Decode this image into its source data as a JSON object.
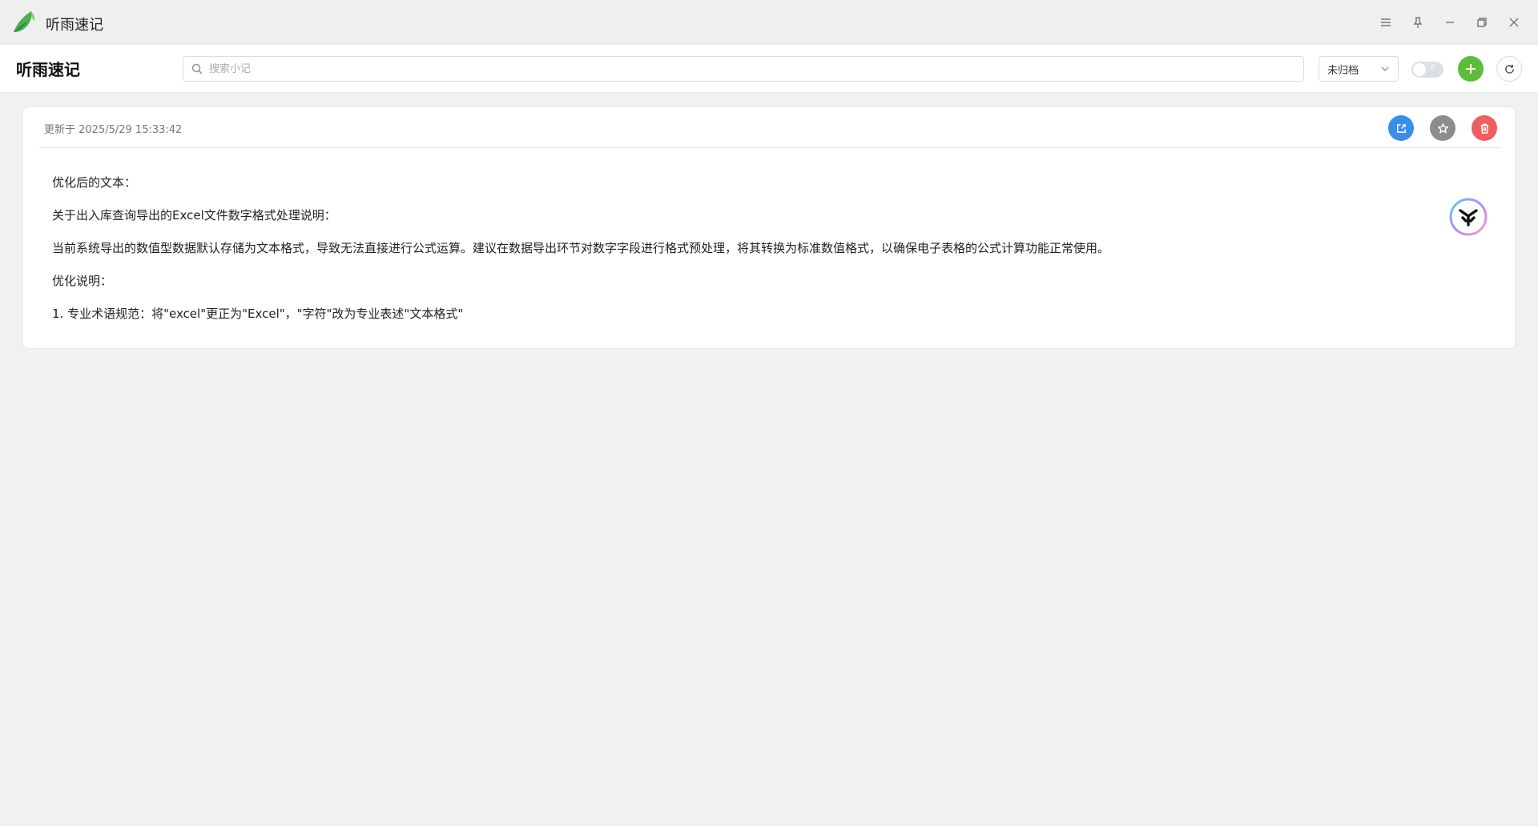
{
  "window": {
    "title": "听雨速记",
    "controls": [
      "menu-icon",
      "pin-icon",
      "minimize-icon",
      "restore-icon",
      "close-icon"
    ]
  },
  "toolbar": {
    "page_title": "听雨速记",
    "search_placeholder": "搜索小记",
    "search_value": "",
    "filter_selected": "未归档",
    "toggle_label": "0",
    "toggle_on": false,
    "add_icon": "plus-icon",
    "refresh_icon": "refresh-icon"
  },
  "note": {
    "updated": "更新于 2025/5/29 15:33:42",
    "actions": [
      "edit-icon",
      "star-icon",
      "trash-icon"
    ],
    "lines": [
      "优化后的文本：",
      "关于出入库查询导出的Excel文件数字格式处理说明：",
      "当前系统导出的数值型数据默认存储为文本格式，导致无法直接进行公式运算。建议在数据导出环节对数字字段进行格式预处理，将其转换为标准数值格式，以确保电子表格的公式计算功能正常使用。",
      "优化说明：",
      "1. 专业术语规范：将\"excel\"更正为\"Excel\"，\"字符\"改为专业表述\"文本格式\""
    ]
  },
  "colors": {
    "accent_green": "#5bbd3a",
    "edit_blue": "#3a8ee6",
    "star_gray": "#8c8c8c",
    "delete_red": "#ee5f5f"
  }
}
